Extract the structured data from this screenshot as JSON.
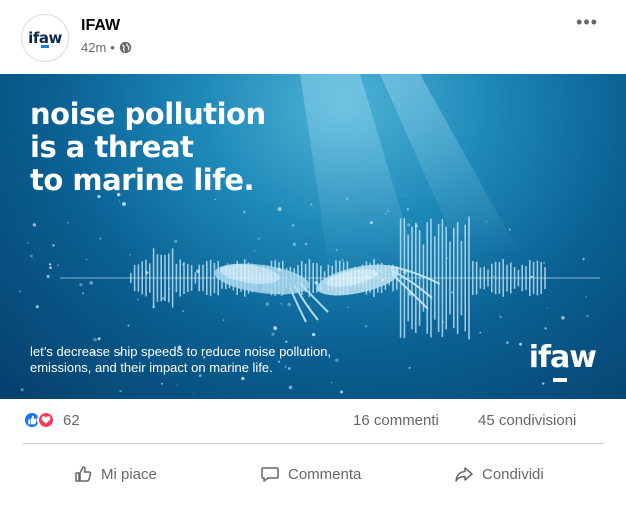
{
  "post": {
    "page_name": "IFAW",
    "avatar_text": "ifaw",
    "time": "42m",
    "separator": "•",
    "more_label": "•••"
  },
  "image": {
    "headline": [
      "noise pollution",
      "is a threat",
      "to marine life."
    ],
    "caption": "let’s decrease ship speeds to reduce noise pollution, emissions, and their impact on marine life.",
    "logo": "ifaw"
  },
  "stats": {
    "reaction_count": "62",
    "comments": "16 commenti",
    "shares": "45 condivisioni"
  },
  "actions": {
    "like": "Mi piace",
    "comment": "Commenta",
    "share": "Condividi"
  },
  "icons": {
    "reaction_like": "thumbs-up-icon",
    "reaction_love": "heart-icon",
    "privacy": "globe-icon"
  },
  "colors": {
    "like_blue": "#1877f2",
    "love_red": "#f33e58",
    "secondary_text": "#65676b"
  }
}
